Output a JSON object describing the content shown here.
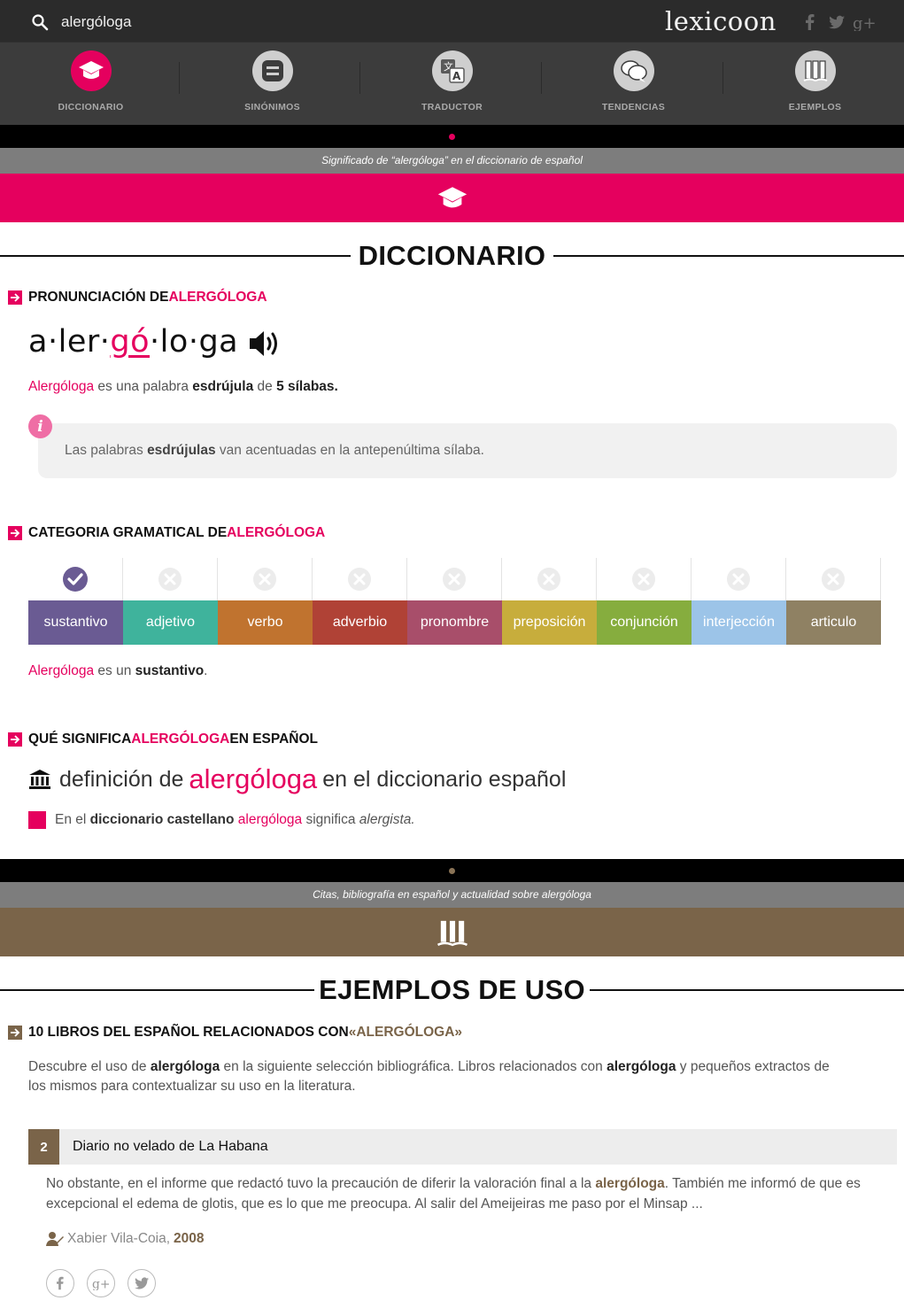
{
  "search": {
    "query": "alergóloga"
  },
  "logo": "lexicoon",
  "nav": {
    "items": [
      {
        "label": "DICCIONARIO",
        "active": true
      },
      {
        "label": "SINÓNIMOS",
        "active": false
      },
      {
        "label": "TRADUCTOR",
        "active": false
      },
      {
        "label": "TENDENCIAS",
        "active": false
      },
      {
        "label": "EJEMPLOS",
        "active": false
      }
    ]
  },
  "colors": {
    "accent": "#e5005e",
    "brown": "#7a6449",
    "dark": "#2b2b2b"
  },
  "dict_banner": {
    "subtitle": "Significado de “alergóloga” en el diccionario de español"
  },
  "dictionary": {
    "title": "DICCIONARIO",
    "pronunciation": {
      "heading_prefix": "PRONUNCIACIÓN DE ",
      "heading_word": "ALERGÓLOGA",
      "syllables": [
        "a",
        "ler",
        "gó",
        "lo",
        "ga"
      ],
      "stressed_index": 2,
      "word": "Alergóloga",
      "text_1": " es una palabra ",
      "type": "esdrújula",
      "text_2": " de ",
      "syllable_count": "5 sílabas.",
      "info_prefix": "Las palabras ",
      "info_bold": "esdrújulas",
      "info_suffix": " van acentuadas en la antepenúltima sílaba."
    },
    "category": {
      "heading_prefix": "CATEGORIA GRAMATICAL DE ",
      "heading_word": "ALERGÓLOGA",
      "items": [
        {
          "label": "sustantivo",
          "color": "#6a5b93",
          "selected": true
        },
        {
          "label": "adjetivo",
          "color": "#3fb39c",
          "selected": false
        },
        {
          "label": "verbo",
          "color": "#c0732f",
          "selected": false
        },
        {
          "label": "adverbio",
          "color": "#b04236",
          "selected": false
        },
        {
          "label": "pronombre",
          "color": "#a84e6a",
          "selected": false
        },
        {
          "label": "preposición",
          "color": "#c7ad3c",
          "selected": false
        },
        {
          "label": "conjunción",
          "color": "#86ad3e",
          "selected": false
        },
        {
          "label": "interjección",
          "color": "#9cc4e8",
          "selected": false
        },
        {
          "label": "articulo",
          "color": "#8f8163",
          "selected": false
        }
      ],
      "word": "Alergóloga",
      "text_1": " es un ",
      "value": "sustantivo",
      "text_2": "."
    },
    "meaning": {
      "heading_prefix": "QUÉ SIGNIFICA ",
      "heading_word": "ALERGÓLOGA",
      "heading_suffix": " EN ESPAÑOL",
      "def_prefix": "definición de",
      "def_word": "alergóloga",
      "def_suffix": "en el diccionario español",
      "entry_prefix": "En el ",
      "entry_bold": "diccionario castellano",
      "entry_word": " alergóloga",
      "entry_mid": " significa ",
      "entry_def": "alergista."
    }
  },
  "examples_banner": {
    "subtitle": "Citas, bibliografía en español y actualidad sobre alergóloga"
  },
  "examples": {
    "title": "EJEMPLOS DE USO",
    "books_heading_prefix": "10 LIBROS DEL ESPAÑOL RELACIONADOS CON ",
    "books_heading_word": "«ALERGÓLOGA»",
    "intro_1": "Descubre el uso de ",
    "intro_word_1": "alergóloga",
    "intro_2": " en la siguiente selección bibliográfica. Libros relacionados con ",
    "intro_word_2": "alergóloga",
    "intro_3": " y pequeños extractos de",
    "intro_4": "los mismos para contextualizar su uso en la literatura.",
    "book": {
      "number": "2",
      "title": "Diario no velado de La Habana",
      "excerpt_1": "No obstante, en el informe que redactó tuvo la precaución de diferir la valoración final a la ",
      "excerpt_word": "alergóloga",
      "excerpt_2": ". También me informó de que es excepcional el edema de glotis, que es lo que me preocupa. Al salir del Ameijeiras me paso por el Minsap  ...",
      "author": "Xabier Vila-Coia,",
      "year": "2008"
    }
  }
}
